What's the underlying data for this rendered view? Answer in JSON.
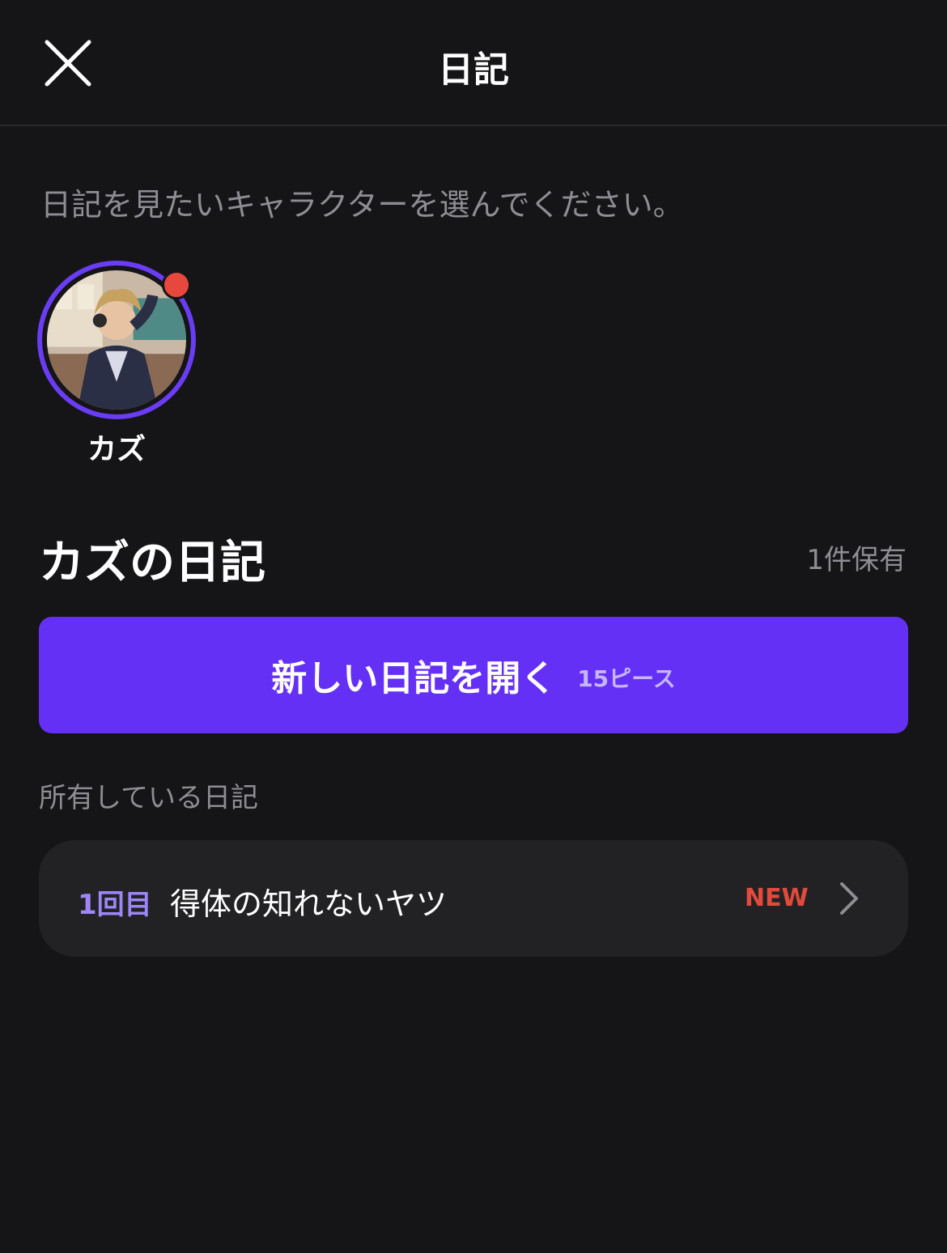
{
  "header": {
    "title": "日記",
    "close_icon": "close-icon"
  },
  "instruction": "日記を見たいキャラクターを選んでください。",
  "characters": [
    {
      "name": "カズ",
      "has_unread": true
    }
  ],
  "diary_section": {
    "title": "カズの日記",
    "owned_count": "1件保有",
    "open_button": {
      "label": "新しい日記を開く",
      "cost": "15ピース"
    },
    "list_heading": "所有している日記",
    "entries": [
      {
        "episode": "1回目",
        "title": "得体の知れないヤツ",
        "badge": "NEW"
      }
    ]
  },
  "colors": {
    "background": "#151417",
    "accent": "#6530f5",
    "ring": "#6a3cf4",
    "new_badge": "#e24a3b",
    "episode_label": "#9d86f7",
    "muted_text": "#8e8d93"
  }
}
